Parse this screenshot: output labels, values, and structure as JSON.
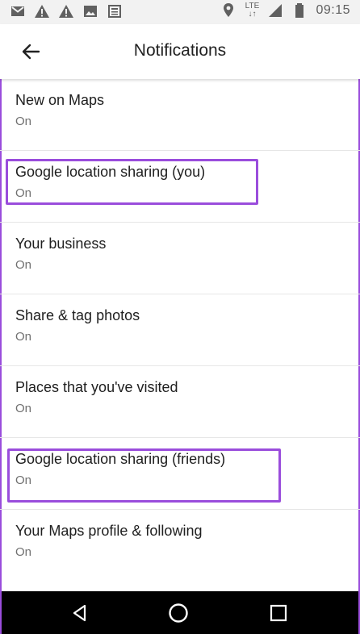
{
  "status_bar": {
    "left_icons": [
      "gmail-icon",
      "warning-icon",
      "warning-icon",
      "image-icon",
      "news-icon"
    ],
    "right_icons": [
      "location-pin-icon",
      "lte-icon",
      "signal-icon",
      "battery-icon"
    ],
    "network": "LTE",
    "time": "09:15"
  },
  "app_bar": {
    "title": "Notifications",
    "back_icon": "arrow-back-icon"
  },
  "settings": [
    {
      "label": "New on Maps",
      "status": "On",
      "highlighted": false
    },
    {
      "label": "Google location sharing (you)",
      "status": "On",
      "highlighted": true
    },
    {
      "label": "Your business",
      "status": "On",
      "highlighted": false
    },
    {
      "label": "Share & tag photos",
      "status": "On",
      "highlighted": false
    },
    {
      "label": "Places that you've visited",
      "status": "On",
      "highlighted": false
    },
    {
      "label": "Google location sharing (friends)",
      "status": "On",
      "highlighted": true
    },
    {
      "label": "Your Maps profile & following",
      "status": "On",
      "highlighted": false
    }
  ],
  "nav_bar": {
    "buttons": [
      "back-triangle-icon",
      "home-circle-icon",
      "recents-square-icon"
    ]
  },
  "colors": {
    "highlight": "#9a4ddc",
    "status_bar_bg": "#f2f2f2",
    "nav_bar_bg": "#000000"
  }
}
